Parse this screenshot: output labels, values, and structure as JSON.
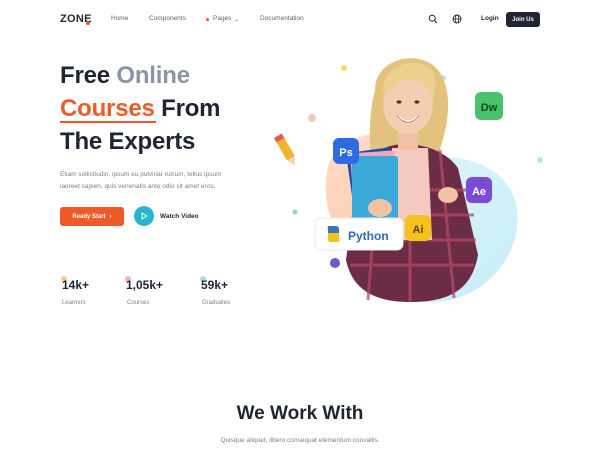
{
  "nav": {
    "logo": "ZONE",
    "links": {
      "home": "Home",
      "components": "Components",
      "pages": "Pages",
      "documentation": "Documentation"
    },
    "login": "Login",
    "join": "Join Us"
  },
  "hero": {
    "title_word1": "Free",
    "title_word2": "Online",
    "title_word3": "Courses",
    "title_word4": "From",
    "title_line3": "The Experts",
    "description_line1": "Etiam sollicitudin, ipsum eu pulvinar rutrum, tellus ipsum",
    "description_line2": "laoreet sapien, quis venenatis ante odio sit amet eros.",
    "cta_start": "Ready Start",
    "cta_video": "Watch Video",
    "python_label": "Python",
    "badges": {
      "ps": "Ps",
      "dw": "Dw",
      "ae": "Ae",
      "ai": "Ai"
    }
  },
  "stats": [
    {
      "value": "14k+",
      "label": "Learners"
    },
    {
      "value": "1,05k+",
      "label": "Courses"
    },
    {
      "value": "59k+",
      "label": "Graduates"
    }
  ],
  "work": {
    "title": "We Work With",
    "subtitle": "Quisque aliquet, libero consequat elementum convallis."
  },
  "colors": {
    "accent": "#f05a28",
    "dark": "#1f2533",
    "teal": "#29b6cc",
    "muted": "#8b93a7"
  }
}
